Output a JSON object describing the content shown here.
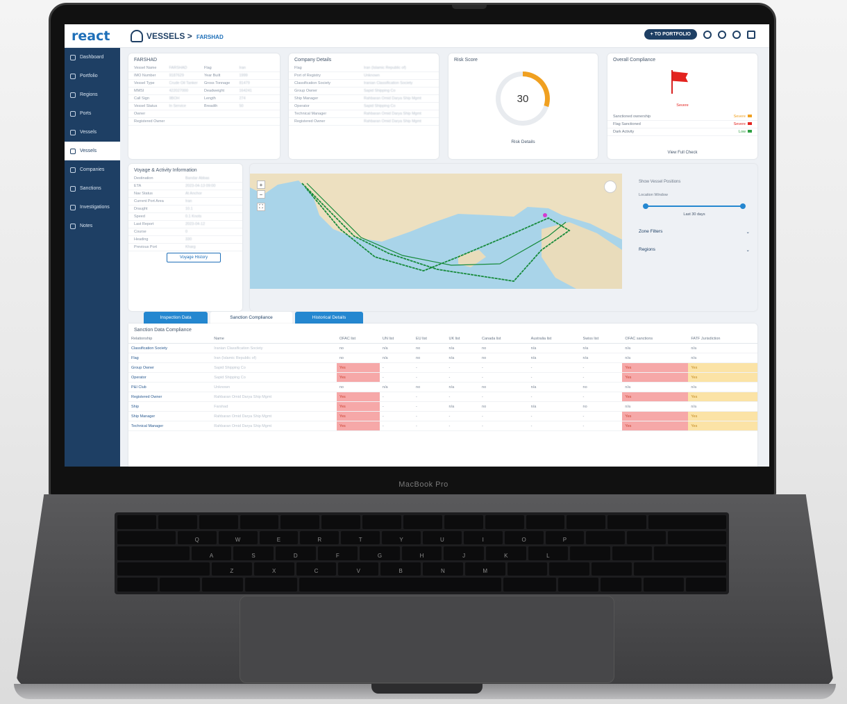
{
  "app": {
    "logo": "react",
    "section": "VESSELS >",
    "vessel_name": "FARSHAD",
    "portfolio_button": "+ TO PORTFOLIO"
  },
  "brand_label": "MacBook Pro",
  "sidebar": {
    "items": [
      {
        "label": "Dashboard",
        "icon": "dashboard-icon"
      },
      {
        "label": "Portfolio",
        "icon": "portfolio-icon"
      },
      {
        "label": "Regions",
        "icon": "regions-icon"
      },
      {
        "label": "Ports",
        "icon": "ports-icon"
      },
      {
        "label": "Vessels",
        "icon": "vessels-icon"
      },
      {
        "label": "Vessels",
        "icon": "ship-icon",
        "active": true
      },
      {
        "label": "Companies",
        "icon": "companies-icon"
      },
      {
        "label": "Sanctions",
        "icon": "sanctions-icon"
      },
      {
        "label": "Investigations",
        "icon": "investigations-icon"
      },
      {
        "label": "Notes",
        "icon": "notes-icon"
      }
    ]
  },
  "vessel_card": {
    "title": "FARSHAD",
    "rows": [
      [
        "Vessel Name",
        "FARSHAD",
        "Flag",
        "Iran"
      ],
      [
        "IMO Number",
        "9187629",
        "Year Built",
        "1999"
      ],
      [
        "Vessel Type",
        "Crude Oil Tanker",
        "Gross Tonnage",
        "81479"
      ],
      [
        "MMSI",
        "422027000",
        "Deadweight",
        "164241"
      ],
      [
        "Call Sign",
        "9BOH",
        "Length",
        "274"
      ],
      [
        "Vessel Status",
        "In Service",
        "Breadth",
        "50"
      ],
      [
        "Owner",
        "",
        "",
        ""
      ],
      [
        "Registered Owner",
        "",
        "",
        ""
      ]
    ]
  },
  "company_card": {
    "title": "Company Details",
    "rows": [
      [
        "Flag",
        "Iran (Islamic Republic of)"
      ],
      [
        "Port of Registry",
        "Unknown"
      ],
      [
        "Classification Society",
        "Iranian Classification Society"
      ],
      [
        "Group Owner",
        "Sapid Shipping Co"
      ],
      [
        "Ship Manager",
        "Rahbaran Omid Darya Ship Mgmt"
      ],
      [
        "Operator",
        "Sapid Shipping Co"
      ],
      [
        "Technical Manager",
        "Rahbaran Omid Darya Ship Mgmt"
      ],
      [
        "Registered Owner",
        "Rahbaran Omid Darya Ship Mgmt"
      ]
    ]
  },
  "risk_card": {
    "title": "Risk Score",
    "score": "30",
    "score_fraction": 0.3,
    "link": "Risk Details"
  },
  "compliance_card": {
    "title": "Overall Compliance",
    "status": "Severe",
    "rows": [
      {
        "label": "Sanctioned ownership",
        "value": "Severe",
        "color": "#f0a020"
      },
      {
        "label": "Flag Sanctioned",
        "value": "Severe",
        "color": "#e3231f"
      },
      {
        "label": "Dark Activity",
        "value": "Low",
        "color": "#2ea043"
      }
    ],
    "link": "View Full Check"
  },
  "voyage_card": {
    "title": "Voyage & Activity Information",
    "rows": [
      [
        "Destination",
        "Bandar Abbas"
      ],
      [
        "ETA",
        "2023-04-13 09:00"
      ],
      [
        "Nav Status",
        "At Anchor"
      ],
      [
        "Current Port Area",
        "Iran"
      ],
      [
        "Draught",
        "10.1"
      ],
      [
        "Speed",
        "0.1 Knots"
      ],
      [
        "Last Report",
        "2023-04-12"
      ],
      [
        "Course",
        "0"
      ],
      [
        "Heading",
        "330"
      ],
      [
        "Previous Port",
        "Kharg"
      ]
    ],
    "button": "Voyage History"
  },
  "map_panel": {
    "legend_toggle": "Show Vessel Positions",
    "slider_label": "Location Window",
    "slider_value": "Last 30 days",
    "filters": "Zone Filters",
    "regions": "Regions"
  },
  "tabs": [
    {
      "label": "Inspection Data"
    },
    {
      "label": "Sanction Compliance",
      "active": true
    },
    {
      "label": "Historical Details"
    }
  ],
  "table": {
    "title": "Sanction Data Compliance",
    "headers": [
      "Relationship",
      "Name",
      "OFAC list",
      "UN list",
      "EU list",
      "UK list",
      "Canada list",
      "Australia list",
      "Swiss list",
      "OFAC sanctions",
      "FATF Jurisdiction"
    ],
    "rows": [
      {
        "rel": "Classification Society",
        "name": "Iranian Classification Society",
        "cells": [
          "no",
          "n/a",
          "no",
          "n/a",
          "no",
          "n/a",
          "n/a",
          "n/a",
          "n/a"
        ],
        "flags": [
          "",
          "",
          "",
          "",
          "",
          "",
          "",
          "",
          ""
        ]
      },
      {
        "rel": "Flag",
        "name": "Iran (Islamic Republic of)",
        "cells": [
          "no",
          "n/a",
          "no",
          "n/a",
          "no",
          "n/a",
          "n/a",
          "n/a",
          "n/a"
        ],
        "flags": [
          "",
          "",
          "",
          "",
          "",
          "",
          "",
          "",
          ""
        ]
      },
      {
        "rel": "Group Owner",
        "name": "Sapid Shipping Co",
        "cells": [
          "Yes",
          "-",
          "-",
          "-",
          "-",
          "-",
          "-",
          "Yes",
          "Yes"
        ],
        "flags": [
          "red",
          "",
          "",
          "",
          "",
          "",
          "",
          "red",
          "amb"
        ]
      },
      {
        "rel": "Operator",
        "name": "Sapid Shipping Co",
        "cells": [
          "Yes",
          "-",
          "-",
          "-",
          "-",
          "-",
          "-",
          "Yes",
          "Yes"
        ],
        "flags": [
          "red",
          "",
          "",
          "",
          "",
          "",
          "",
          "red",
          "amb"
        ]
      },
      {
        "rel": "P&I Club",
        "name": "Unknown",
        "cells": [
          "no",
          "n/a",
          "no",
          "n/a",
          "no",
          "n/a",
          "no",
          "n/a",
          "n/a"
        ],
        "flags": [
          "",
          "",
          "",
          "",
          "",
          "",
          "",
          "",
          ""
        ]
      },
      {
        "rel": "Registered Owner",
        "name": "Rahbaran Omid Darya Ship Mgmt",
        "cells": [
          "Yes",
          "-",
          "-",
          "-",
          "-",
          "-",
          "-",
          "Yes",
          "Yes"
        ],
        "flags": [
          "red",
          "",
          "",
          "",
          "",
          "",
          "",
          "red",
          "amb"
        ]
      },
      {
        "rel": "Ship",
        "name": "Farshad",
        "cells": [
          "Yes",
          "-",
          "-",
          "n/a",
          "no",
          "n/a",
          "no",
          "n/a",
          "n/a"
        ],
        "flags": [
          "red",
          "",
          "",
          "",
          "",
          "",
          "",
          "",
          ""
        ]
      },
      {
        "rel": "Ship Manager",
        "name": "Rahbaran Omid Darya Ship Mgmt",
        "cells": [
          "Yes",
          "-",
          "-",
          "-",
          "-",
          "-",
          "-",
          "Yes",
          "Yes"
        ],
        "flags": [
          "red",
          "",
          "",
          "",
          "",
          "",
          "",
          "red",
          "amb"
        ]
      },
      {
        "rel": "Technical Manager",
        "name": "Rahbaran Omid Darya Ship Mgmt",
        "cells": [
          "Yes",
          "-",
          "-",
          "-",
          "-",
          "-",
          "-",
          "Yes",
          "Yes"
        ],
        "flags": [
          "red",
          "",
          "",
          "",
          "",
          "",
          "",
          "red",
          "amb"
        ]
      }
    ]
  },
  "colors": {
    "sidebar": "#1e3f64",
    "accent": "#2487d0",
    "danger": "#e3231f",
    "warning": "#f0a020"
  }
}
